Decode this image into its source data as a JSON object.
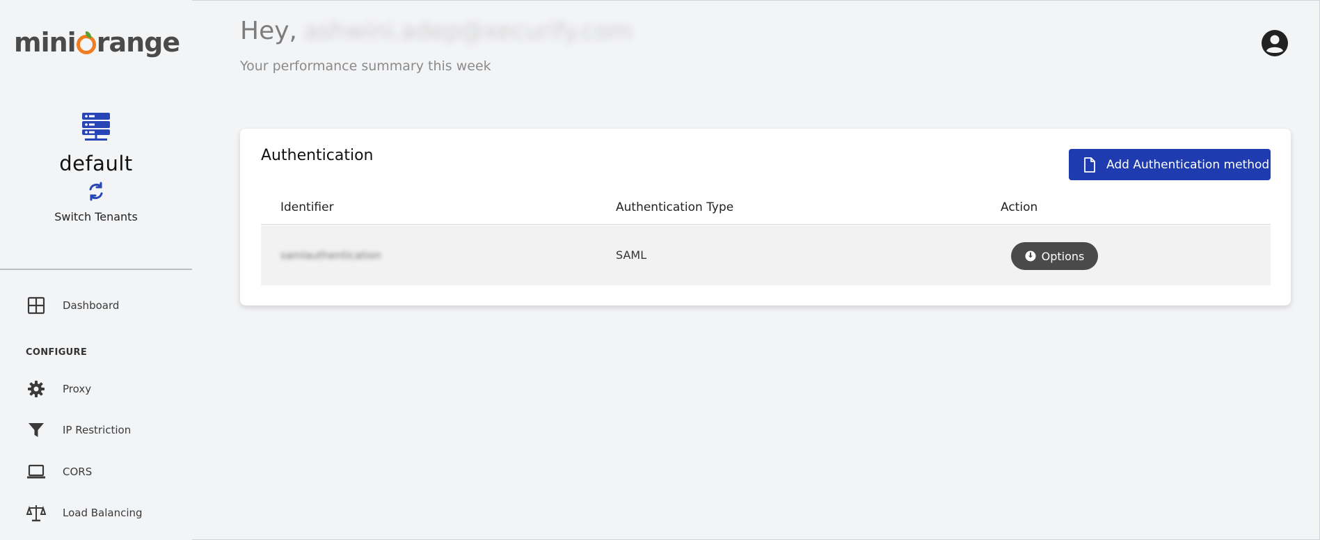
{
  "sidebar": {
    "logo": {
      "part1": "mini",
      "part2": "range"
    },
    "tenant": {
      "name": "default",
      "switch_label": "Switch Tenants"
    },
    "items": [
      {
        "label": "Dashboard"
      },
      {
        "label": "Proxy"
      },
      {
        "label": "IP Restriction"
      },
      {
        "label": "CORS"
      },
      {
        "label": "Load Balancing"
      }
    ],
    "section_label": "CONFIGURE"
  },
  "header": {
    "greeting_prefix": "Hey,",
    "email": "ashwini.adep@xecurify.com",
    "subtitle": "Your performance summary this week"
  },
  "card": {
    "title": "Authentication",
    "add_button_label": "Add Authentication method",
    "columns": [
      "Identifier",
      "Authentication Type",
      "Action"
    ],
    "rows": [
      {
        "identifier": "samlauthentication",
        "type": "SAML",
        "action_label": "Options"
      }
    ]
  },
  "colors": {
    "primary": "#1e3bb0",
    "sidebar_icon_blue": "#2845b7",
    "logo_orange": "#f07c1f",
    "options_button": "#4a4a4a",
    "background": "#f3f4f6"
  },
  "icons": {
    "tenant": "server-icon",
    "switch": "refresh-icon",
    "dashboard": "grid-icon",
    "proxy": "gear-icon",
    "ip_restriction": "filter-icon",
    "cors": "laptop-icon",
    "load_balancing": "scale-icon",
    "avatar": "user-circle-icon",
    "add": "document-icon",
    "options": "download-circle-icon"
  }
}
